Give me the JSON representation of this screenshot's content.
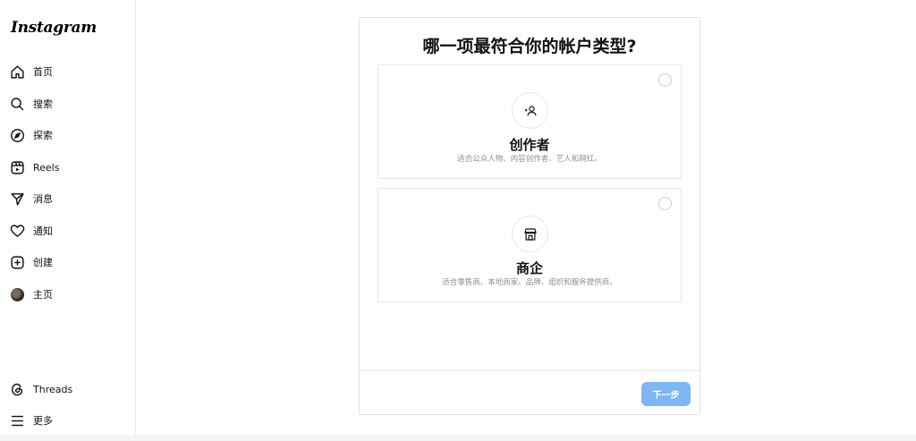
{
  "sidebar": {
    "logo": "Instagram",
    "items": [
      {
        "label": "首页",
        "icon": "home-icon"
      },
      {
        "label": "搜索",
        "icon": "search-icon"
      },
      {
        "label": "探索",
        "icon": "compass-icon"
      },
      {
        "label": "Reels",
        "icon": "reels-icon"
      },
      {
        "label": "消息",
        "icon": "send-icon"
      },
      {
        "label": "通知",
        "icon": "heart-icon"
      },
      {
        "label": "创建",
        "icon": "plus-square-icon"
      },
      {
        "label": "主页",
        "icon": "avatar"
      }
    ],
    "bottom_items": [
      {
        "label": "Threads",
        "icon": "threads-icon"
      },
      {
        "label": "更多",
        "icon": "menu-icon"
      }
    ]
  },
  "dialog": {
    "title": "哪一项最符合你的帐户类型?",
    "options": [
      {
        "title": "创作者",
        "description": "适合公众人物、内容创作者、艺人和网红。",
        "icon": "creator-icon",
        "selected": false
      },
      {
        "title": "商企",
        "description": "适合零售商、本地商家、品牌、组织和服务提供商。",
        "icon": "shop-icon",
        "selected": false
      }
    ],
    "next_label": "下一步"
  },
  "colors": {
    "primary_button": "#7fb5f2",
    "border": "#e2e2e2",
    "muted_text": "#8e8e8e"
  }
}
